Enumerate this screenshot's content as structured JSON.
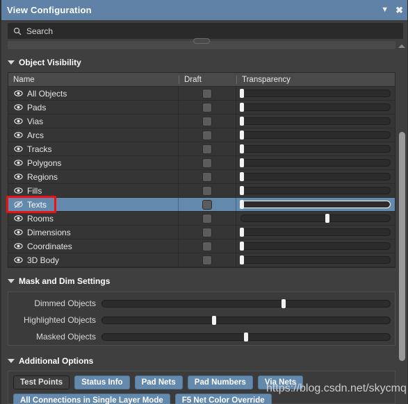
{
  "window": {
    "title": "View Configuration",
    "dropdown_icon": "chevron-down-icon",
    "close_icon": "close-icon"
  },
  "search": {
    "icon": "search-icon",
    "placeholder": "Search",
    "value": ""
  },
  "object_visibility": {
    "section_label": "Object Visibility",
    "expanded": true,
    "columns": [
      "Name",
      "Draft",
      "Transparency"
    ],
    "rows": [
      {
        "name": "All Objects",
        "visible": true,
        "draft": false,
        "transparency": 1,
        "selected": false
      },
      {
        "name": "Pads",
        "visible": true,
        "draft": false,
        "transparency": 1,
        "selected": false
      },
      {
        "name": "Vias",
        "visible": true,
        "draft": false,
        "transparency": 1,
        "selected": false
      },
      {
        "name": "Arcs",
        "visible": true,
        "draft": false,
        "transparency": 1,
        "selected": false
      },
      {
        "name": "Tracks",
        "visible": true,
        "draft": false,
        "transparency": 1,
        "selected": false
      },
      {
        "name": "Polygons",
        "visible": true,
        "draft": false,
        "transparency": 1,
        "selected": false
      },
      {
        "name": "Regions",
        "visible": true,
        "draft": false,
        "transparency": 1,
        "selected": false
      },
      {
        "name": "Fills",
        "visible": true,
        "draft": false,
        "transparency": 1,
        "selected": false
      },
      {
        "name": "Texts",
        "visible": false,
        "draft": false,
        "transparency": 1,
        "selected": true
      },
      {
        "name": "Rooms",
        "visible": true,
        "draft": false,
        "transparency": 58,
        "selected": false
      },
      {
        "name": "Dimensions",
        "visible": true,
        "draft": false,
        "transparency": 1,
        "selected": false
      },
      {
        "name": "Coordinates",
        "visible": true,
        "draft": false,
        "transparency": 1,
        "selected": false
      },
      {
        "name": "3D Body",
        "visible": true,
        "draft": false,
        "transparency": 1,
        "selected": false
      }
    ]
  },
  "mask_and_dim": {
    "section_label": "Mask and Dim Settings",
    "expanded": true,
    "sliders": [
      {
        "label": "Dimmed Objects",
        "value": 63
      },
      {
        "label": "Highlighted Objects",
        "value": 39
      },
      {
        "label": "Masked Objects",
        "value": 50
      }
    ]
  },
  "additional_options": {
    "section_label": "Additional Options",
    "expanded": true,
    "buttons_row1": [
      {
        "label": "Test Points",
        "on": false
      },
      {
        "label": "Status Info",
        "on": true
      },
      {
        "label": "Pad Nets",
        "on": true
      },
      {
        "label": "Pad Numbers",
        "on": true
      },
      {
        "label": "Via Nets",
        "on": true
      }
    ],
    "buttons_row2": [
      {
        "label": "All Connections in Single Layer Mode",
        "on": true
      },
      {
        "label": "F5  Net Color Override",
        "on": true
      }
    ]
  },
  "annotation": {
    "type": "red-rectangle-highlight",
    "target": "Texts visibility eye icon and label"
  },
  "watermark": {
    "text": "https://blog.csdn.net/skycmq"
  },
  "colors": {
    "title_bar": "#5F82A6",
    "selection": "#6389AD",
    "panel_bg": "#3F3F3F",
    "table_bg": "#353535",
    "header_bg": "#4A4A4A",
    "annotation": "#EE1111"
  }
}
